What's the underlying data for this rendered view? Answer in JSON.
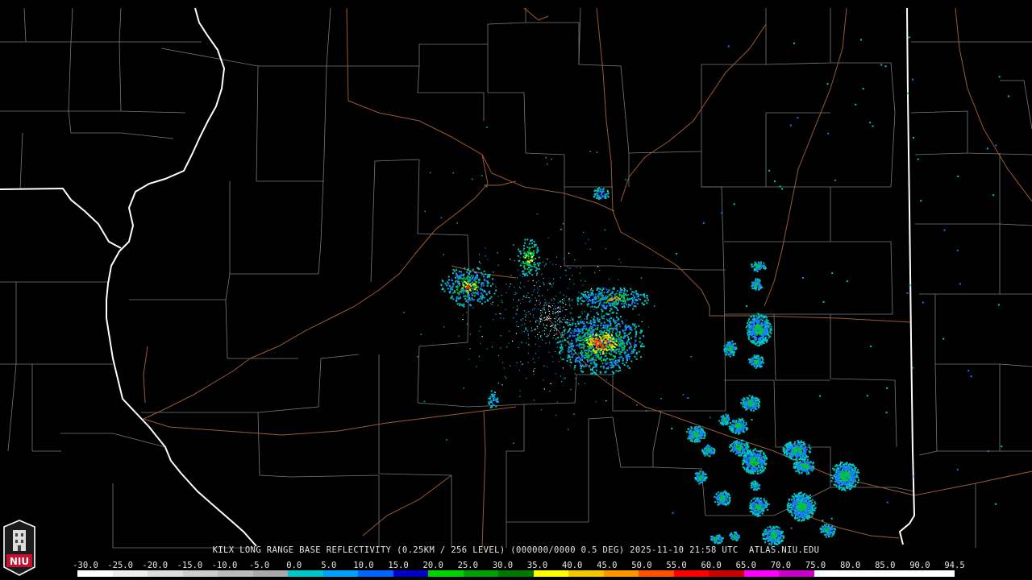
{
  "caption": "KILX LONG RANGE BASE REFLECTIVITY (0.25KM / 256 LEVEL) (000000/0000 0.5 DEG) 2025-11-10 21:58 UTC  ATLAS.NIU.EDU",
  "logo_text": "NIU",
  "colorbar": {
    "labels": [
      "-30.0",
      "-25.0",
      "-20.0",
      "-15.0",
      "-10.0",
      "-5.0",
      "0.0",
      "5.0",
      "10.0",
      "15.0",
      "20.0",
      "25.0",
      "30.0",
      "35.0",
      "40.0",
      "45.0",
      "50.0",
      "55.0",
      "60.0",
      "65.0",
      "70.0",
      "75.0",
      "80.0",
      "85.0",
      "90.0",
      "94.5"
    ],
    "colors": [
      "#ffffff",
      "#eeeeee",
      "#dddddd",
      "#cccccc",
      "#bbbbbb",
      "#aaaaaa",
      "#00c8c8",
      "#00a0ff",
      "#0064ff",
      "#0000c8",
      "#00d200",
      "#00a000",
      "#007800",
      "#ffff00",
      "#f0c800",
      "#ff9600",
      "#ff5000",
      "#ff0000",
      "#c80000",
      "#ff00ff",
      "#c800c8",
      "#ffffff",
      "#ffffff",
      "#ffffff",
      "#ffffff"
    ]
  },
  "map": {
    "radar_site": "KILX",
    "state_border_color": "#ffffff",
    "county_border_color": "#7a7a7a",
    "highway_color": "#9b5a32",
    "echo_colors": {
      "light": "#00c8c8",
      "blue": "#1e78ff",
      "green": "#00c832",
      "yellow": "#f0f000",
      "orange": "#ff9600",
      "red": "#ff2800"
    }
  }
}
